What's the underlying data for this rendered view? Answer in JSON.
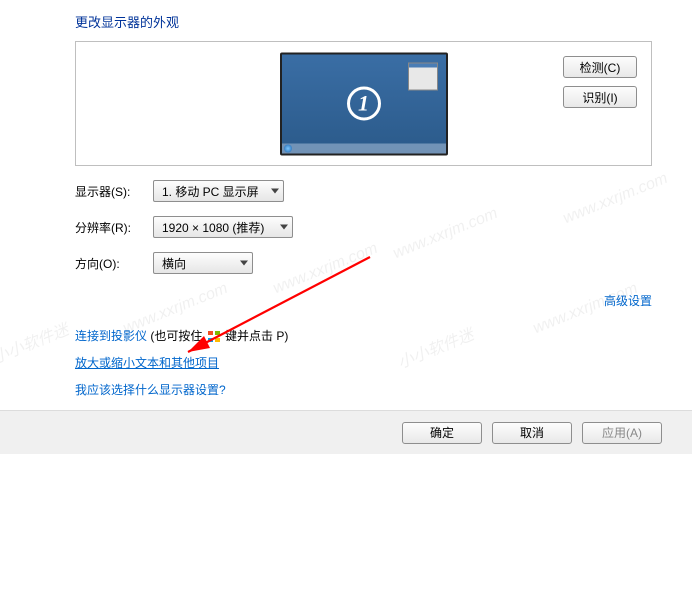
{
  "title": "更改显示器的外观",
  "monitor_number": "1",
  "buttons": {
    "detect": "检测(C)",
    "identify": "识别(I)",
    "ok": "确定",
    "cancel": "取消",
    "apply": "应用(A)"
  },
  "labels": {
    "display": "显示器(S):",
    "resolution": "分辨率(R):",
    "orientation": "方向(O):"
  },
  "dropdowns": {
    "display": "1. 移动 PC 显示屏",
    "resolution": "1920 × 1080 (推荐)",
    "orientation": "横向"
  },
  "links": {
    "advanced": "高级设置",
    "projector_a": "连接到投影仪",
    "projector_b": " (也可按住 ",
    "projector_c": " 键并点击 P)",
    "textsize": "放大或缩小文本和其他项目",
    "help": "我应该选择什么显示器设置?"
  },
  "watermark_cn": "小小软件迷",
  "watermark_url": "www.xxrjm.com"
}
